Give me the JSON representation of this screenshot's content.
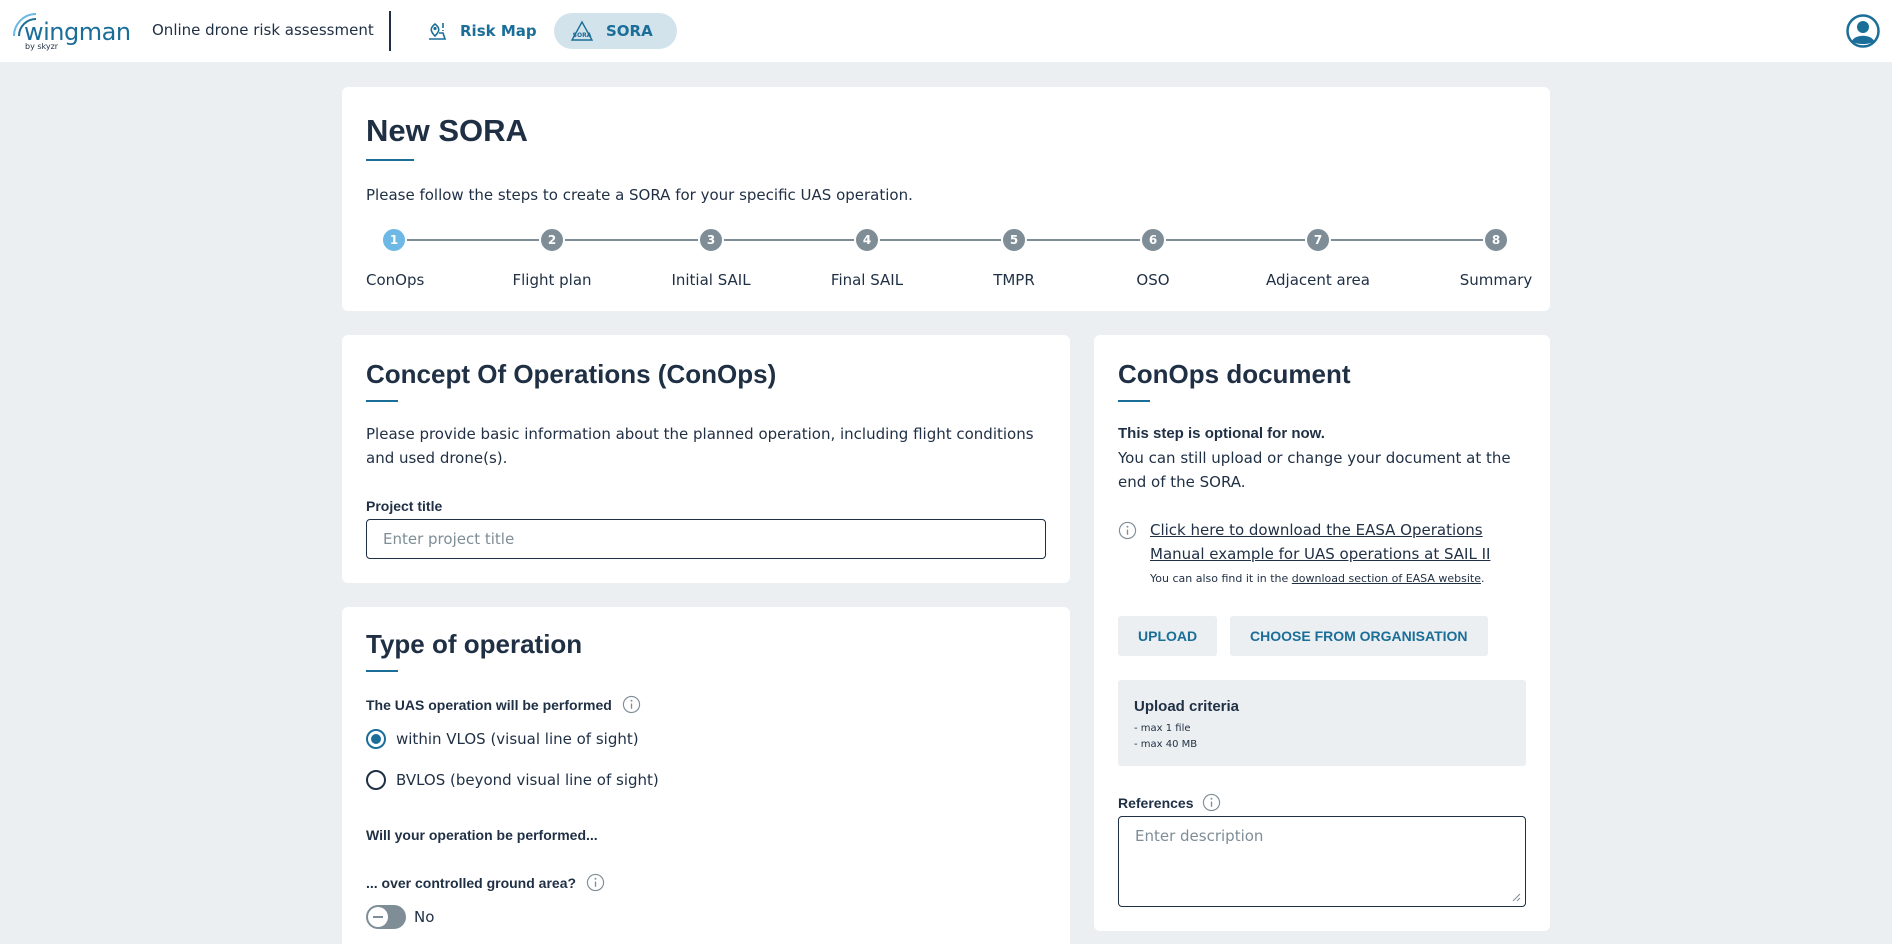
{
  "header": {
    "logo_text": "wingman",
    "logo_sub": "by skyzr",
    "tagline": "Online drone risk assessment",
    "nav": [
      {
        "label": "Risk Map",
        "icon": "map-pin-icon",
        "active": false
      },
      {
        "label": "SORA",
        "icon": "sora-icon",
        "active": true
      }
    ],
    "avatar_icon": "user-avatar-icon"
  },
  "intro": {
    "title": "New SORA",
    "description": "Please follow the steps to create a SORA for your specific UAS operation.",
    "steps": [
      {
        "number": "1",
        "label": "ConOps",
        "active": true
      },
      {
        "number": "2",
        "label": "Flight plan",
        "active": false
      },
      {
        "number": "3",
        "label": "Initial SAIL",
        "active": false
      },
      {
        "number": "4",
        "label": "Final SAIL",
        "active": false
      },
      {
        "number": "5",
        "label": "TMPR",
        "active": false
      },
      {
        "number": "6",
        "label": "OSO",
        "active": false
      },
      {
        "number": "7",
        "label": "Adjacent area",
        "active": false
      },
      {
        "number": "8",
        "label": "Summary",
        "active": false
      }
    ]
  },
  "conops": {
    "title": "Concept Of Operations (ConOps)",
    "description": "Please provide basic information about the planned operation, including flight conditions and used drone(s).",
    "project_title_label": "Project title",
    "project_title_placeholder": "Enter project title"
  },
  "type_of_operation": {
    "title": "Type of operation",
    "question": "The UAS operation will be performed",
    "options": [
      {
        "label": "within VLOS (visual line of sight)",
        "checked": true
      },
      {
        "label": "BVLOS (beyond visual line of sight)",
        "checked": false
      }
    ],
    "subheading": "Will your operation be performed...",
    "ground_area_question": "... over controlled ground area?",
    "ground_area_value": "No"
  },
  "conops_document": {
    "title": "ConOps document",
    "optional_note": "This step is optional for now.",
    "optional_detail": "You can still upload or change your document at the end of the SORA.",
    "download_link": "Click here to download the EASA Operations Manual example for UAS operations at SAIL II",
    "find_prefix": "You can also find it in the ",
    "find_link": "download section of EASA website",
    "find_suffix": ".",
    "upload_button": "UPLOAD",
    "choose_button": "CHOOSE FROM ORGANISATION",
    "criteria_title": "Upload criteria",
    "criteria": [
      "- max 1 file",
      "- max 40 MB"
    ],
    "references_label": "References",
    "references_placeholder": "Enter description"
  },
  "colors": {
    "accent": "#1a6e98",
    "text": "#1f2f44",
    "background": "#ebeff1",
    "step_active": "#6db8e4",
    "step_inactive": "#7e8d96"
  }
}
